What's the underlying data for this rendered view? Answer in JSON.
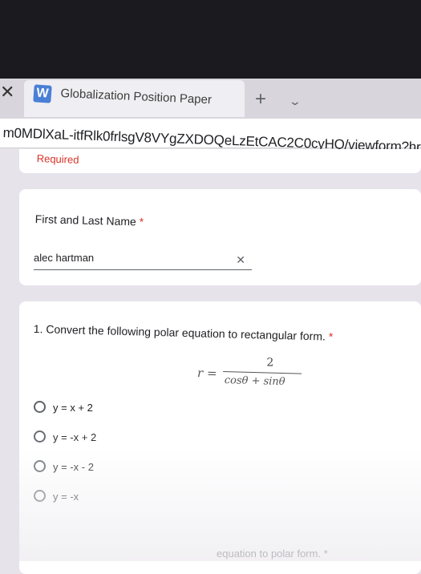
{
  "browser": {
    "tab": {
      "close_glyph": "✕",
      "favicon_letter": "W",
      "title": "Globalization Position Paper"
    },
    "new_tab_glyph": "+",
    "tab_dropdown_glyph": "⌄",
    "address": "m0MDlXaL-itfRlk0frlsgV8VYgZXDOQeLzEtCAC2C0cyHQ/viewform?hr"
  },
  "form": {
    "required_note": "Required",
    "name_question": {
      "label": "First and Last Name",
      "required_mark": "*",
      "value": "alec hartman",
      "clear_glyph": "✕"
    },
    "question1": {
      "label": "1. Convert the following polar equation to rectangular form.",
      "required_mark": "*",
      "formula": {
        "lhs": "r =",
        "numerator": "2",
        "denominator": "cosθ + sinθ"
      },
      "options": [
        "y = x + 2",
        "y = -x + 2",
        "y = -x - 2",
        "y = -x"
      ]
    },
    "question2_partial": "equation to polar form. *"
  },
  "colors": {
    "accent_required": "#d93025",
    "favicon": "#4a7fd6"
  }
}
